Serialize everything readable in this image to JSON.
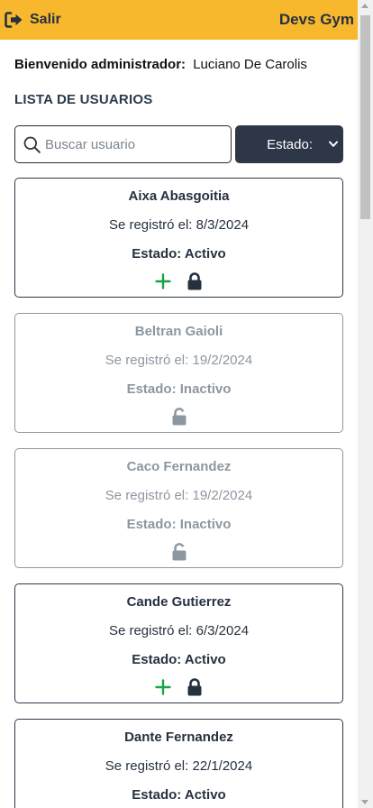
{
  "header": {
    "logout_label": "Salir",
    "logout_icon": "sign-out-icon",
    "brand": "Devs Gym",
    "background": "#f8b82d"
  },
  "welcome": {
    "label": "Bienvenido administrador:",
    "name": "Luciano De Carolis"
  },
  "section_title": "LISTA DE USUARIOS",
  "search": {
    "placeholder": "Buscar usuario",
    "value": "",
    "icon": "search-icon"
  },
  "status_filter": {
    "label": "Estado:",
    "background": "#2d3748"
  },
  "users": [
    {
      "name": "Aixa Abasgoitia",
      "registered": "Se registró el: 8/3/2024",
      "status": "Estado: Activo",
      "active": true
    },
    {
      "name": "Beltran Gaioli",
      "registered": "Se registró el: 19/2/2024",
      "status": "Estado: Inactivo",
      "active": false
    },
    {
      "name": "Caco Fernandez",
      "registered": "Se registró el: 19/2/2024",
      "status": "Estado: Inactivo",
      "active": false
    },
    {
      "name": "Cande Gutierrez",
      "registered": "Se registró el: 6/3/2024",
      "status": "Estado: Activo",
      "active": true
    },
    {
      "name": "Dante Fernandez",
      "registered": "Se registró el: 22/1/2024",
      "status": "Estado: Activo",
      "active": true
    }
  ],
  "colors": {
    "add_green": "#1aa34a",
    "lock_dark": "#263140",
    "inactive_gray": "#8d97a1"
  }
}
